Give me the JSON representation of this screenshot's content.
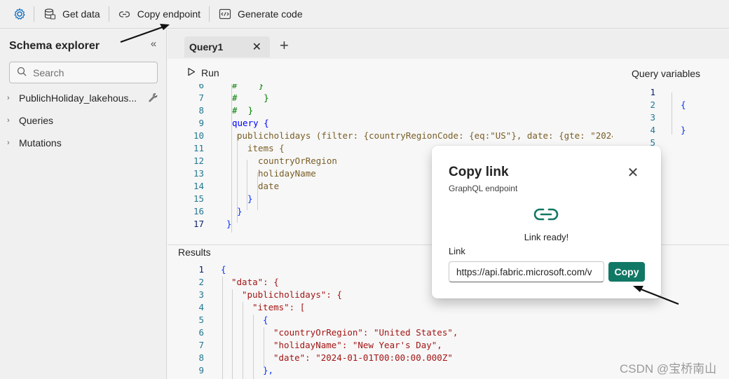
{
  "toolbar": {
    "items": [
      {
        "label": "Get data",
        "icon": "database-icon"
      },
      {
        "label": "Copy endpoint",
        "icon": "link-icon"
      },
      {
        "label": "Generate code",
        "icon": "code-icon"
      }
    ]
  },
  "sidebar": {
    "title": "Schema explorer",
    "search_placeholder": "Search",
    "items": [
      {
        "label": "PublichHoliday_lakehous..."
      },
      {
        "label": "Queries"
      },
      {
        "label": "Mutations"
      }
    ]
  },
  "main": {
    "tab_label": "Query1",
    "run_label": "Run",
    "query_variables_title": "Query variables",
    "results_title": "Results"
  },
  "editor": {
    "lines": [
      {
        "n": "6",
        "text": "#    }"
      },
      {
        "n": "7",
        "text": "#     }"
      },
      {
        "n": "8",
        "text": "#  }"
      },
      {
        "n": "9",
        "text": "query {"
      },
      {
        "n": "10",
        "text": "publicholidays (filter: {countryRegionCode: {eq:\"US\"}, date: {gte: \"2024-"
      },
      {
        "n": "11",
        "text": "items {"
      },
      {
        "n": "12",
        "text": "countryOrRegion"
      },
      {
        "n": "13",
        "text": "holidayName"
      },
      {
        "n": "14",
        "text": "date"
      },
      {
        "n": "15",
        "text": "}"
      },
      {
        "n": "16",
        "text": "}"
      },
      {
        "n": "17",
        "text": "}"
      }
    ]
  },
  "query_variables": {
    "lines": [
      {
        "n": "1",
        "text": ""
      },
      {
        "n": "2",
        "text": "{"
      },
      {
        "n": "3",
        "text": ""
      },
      {
        "n": "4",
        "text": "}"
      },
      {
        "n": "5",
        "text": ""
      }
    ]
  },
  "results": {
    "lines": [
      {
        "n": "1",
        "text": "{"
      },
      {
        "n": "2",
        "text": "\"data\": {"
      },
      {
        "n": "3",
        "text": "\"publicholidays\": {"
      },
      {
        "n": "4",
        "text": "\"items\": ["
      },
      {
        "n": "5",
        "text": "{"
      },
      {
        "n": "6",
        "text": "\"countryOrRegion\": \"United States\","
      },
      {
        "n": "7",
        "text": "\"holidayName\": \"New Year's Day\","
      },
      {
        "n": "8",
        "text": "\"date\": \"2024-01-01T00:00:00.000Z\""
      },
      {
        "n": "9",
        "text": "},"
      }
    ]
  },
  "dialog": {
    "title": "Copy link",
    "subtitle": "GraphQL endpoint",
    "status": "Link ready!",
    "field_label": "Link",
    "field_value": "https://api.fabric.microsoft.com/v",
    "copy_label": "Copy"
  },
  "watermark": "CSDN @宝桥南山",
  "colors": {
    "accent": "#117865",
    "icon_blue": "#0f6cbd",
    "link_icon": "#117865"
  }
}
